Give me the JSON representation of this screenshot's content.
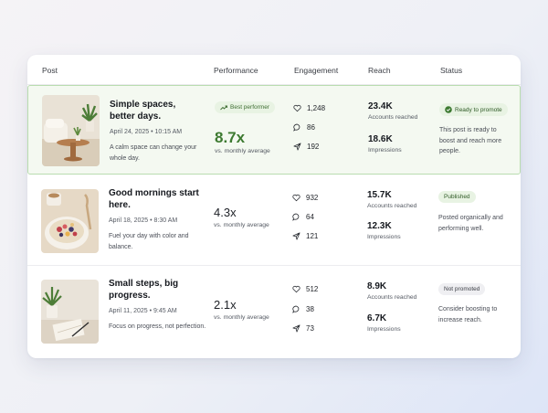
{
  "headers": {
    "post": "Post",
    "performance": "Performance",
    "engagement": "Engagement",
    "reach": "Reach",
    "status": "Status"
  },
  "posts": [
    {
      "title": "Simple spaces, better days.",
      "date": "April 24, 2025  •  10:15 AM",
      "description": "A calm space can change your whole day.",
      "badge": "Best performer",
      "multiplier": "8.7x",
      "multiplier_label": "vs. monthly average",
      "likes": "1,248",
      "comments": "86",
      "shares": "192",
      "accounts_reached": "23.4K",
      "accounts_label": "Accounts reached",
      "impressions": "18.6K",
      "impressions_label": "Impressions",
      "status": "Ready to promote",
      "status_note": "This post is ready to boost and reach more people."
    },
    {
      "title": "Good mornings start here.",
      "date": "April 18, 2025  •  8:30 AM",
      "description": "Fuel your day with color and balance.",
      "multiplier": "4.3x",
      "multiplier_label": "vs. monthly average",
      "likes": "932",
      "comments": "64",
      "shares": "121",
      "accounts_reached": "15.7K",
      "accounts_label": "Accounts reached",
      "impressions": "12.3K",
      "impressions_label": "Impressions",
      "status": "Published",
      "status_note": "Posted organically and performing well."
    },
    {
      "title": "Small steps, big progress.",
      "date": "April 11, 2025  •  9:45 AM",
      "description": "Focus on progress, not perfection.",
      "multiplier": "2.1x",
      "multiplier_label": "vs. monthly average",
      "likes": "512",
      "comments": "38",
      "shares": "73",
      "accounts_reached": "8.9K",
      "accounts_label": "Accounts reached",
      "impressions": "6.7K",
      "impressions_label": "Impressions",
      "status": "Not promoted",
      "status_note": "Consider boosting to increase reach."
    }
  ],
  "icons": {
    "like": "heart-icon",
    "comment": "comment-icon",
    "share": "send-icon",
    "trend": "trend-up-icon",
    "check": "check-circle-icon"
  },
  "colors": {
    "accent_green": "#3d7a31",
    "best_row_bg": "#f4f9f1",
    "best_row_border": "#b9dcaf"
  }
}
